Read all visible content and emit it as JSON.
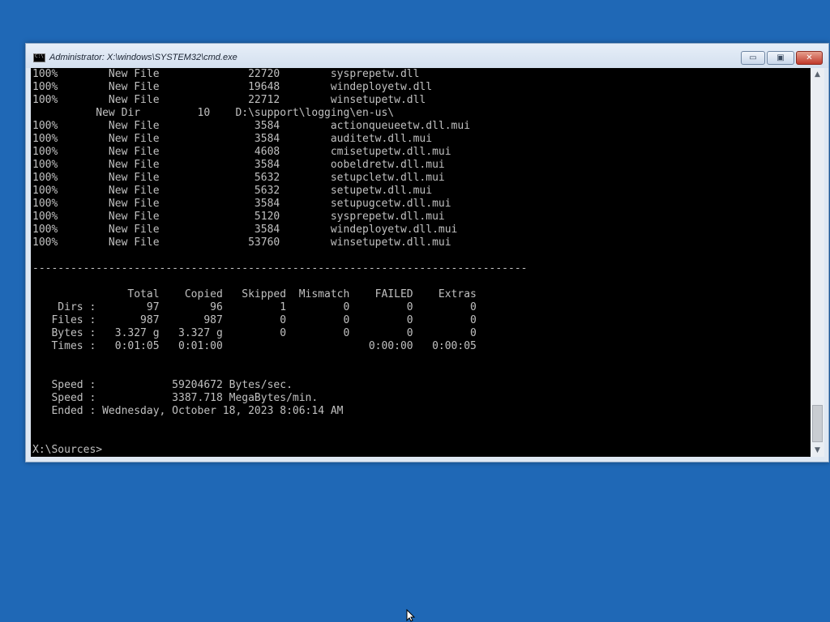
{
  "window": {
    "title": "Administrator: X:\\windows\\SYSTEM32\\cmd.exe",
    "buttons": {
      "minimize": "▭",
      "maximize": "▣",
      "close": "✕"
    }
  },
  "console": {
    "lines": [
      "100%        New File              22720        sysprepetw.dll",
      "100%        New File              19648        windeployetw.dll",
      "100%        New File              22712        winsetupetw.dll",
      "          New Dir         10    D:\\support\\logging\\en-us\\",
      "100%        New File               3584        actionqueueetw.dll.mui",
      "100%        New File               3584        auditetw.dll.mui",
      "100%        New File               4608        cmisetupetw.dll.mui",
      "100%        New File               3584        oobeldretw.dll.mui",
      "100%        New File               5632        setupcletw.dll.mui",
      "100%        New File               5632        setupetw.dll.mui",
      "100%        New File               3584        setupugcetw.dll.mui",
      "100%        New File               5120        sysprepetw.dll.mui",
      "100%        New File               3584        windeployetw.dll.mui",
      "100%        New File              53760        winsetupetw.dll.mui",
      "",
      "------------------------------------------------------------------------------",
      "",
      "               Total    Copied   Skipped  Mismatch    FAILED    Extras",
      "    Dirs :        97        96         1         0         0         0",
      "   Files :       987       987         0         0         0         0",
      "   Bytes :   3.327 g   3.327 g         0         0         0         0",
      "   Times :   0:01:05   0:01:00                       0:00:00   0:00:05",
      "",
      "",
      "   Speed :            59204672 Bytes/sec.",
      "   Speed :            3387.718 MegaBytes/min.",
      "   Ended : Wednesday, October 18, 2023 8:06:14 AM",
      "",
      "",
      "X:\\Sources>"
    ]
  },
  "scrollbar": {
    "up_arrow": "▲",
    "down_arrow": "▼"
  },
  "colors": {
    "desktop": "#1f68b6",
    "console_bg": "#000000",
    "console_fg": "#c0c0c0"
  }
}
